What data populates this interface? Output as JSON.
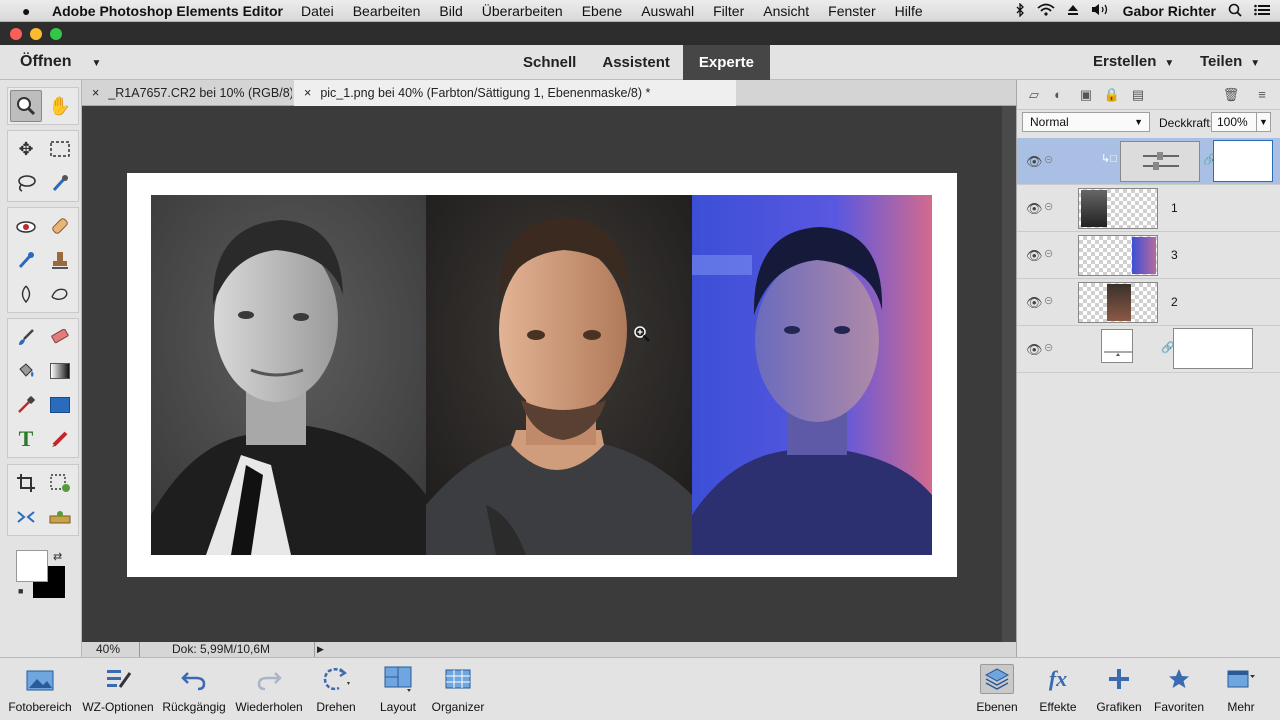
{
  "menubar": {
    "app_name": "Adobe Photoshop Elements Editor",
    "items": [
      "Datei",
      "Bearbeiten",
      "Bild",
      "Überarbeiten",
      "Ebene",
      "Auswahl",
      "Filter",
      "Ansicht",
      "Fenster",
      "Hilfe"
    ],
    "user": "Gabor Richter"
  },
  "modebar": {
    "open_label": "Öffnen",
    "modes": [
      "Schnell",
      "Assistent",
      "Experte"
    ],
    "active_mode": "Experte",
    "create_label": "Erstellen",
    "share_label": "Teilen"
  },
  "tabs": [
    {
      "label": "_R1A7657.CR2 bei 10% (RGB/8)",
      "active": false
    },
    {
      "label": "pic_1.png bei 40% (Farbton/Sättigung 1, Ebenenmaske/8) *",
      "active": true
    }
  ],
  "status": {
    "zoom": "40%",
    "doc": "Dok: 5,99M/10,6M"
  },
  "layers_panel": {
    "blend_mode": "Normal",
    "opacity_label": "Deckkraft:",
    "opacity_value": "100%",
    "layers": [
      {
        "name": "",
        "type": "adjustment",
        "selected": true
      },
      {
        "name": "1",
        "type": "image",
        "selected": false
      },
      {
        "name": "3",
        "type": "image",
        "selected": false
      },
      {
        "name": "2",
        "type": "image",
        "selected": false
      },
      {
        "name": "",
        "type": "background",
        "selected": false
      }
    ]
  },
  "bottombar": {
    "items": [
      {
        "label": "Fotobereich",
        "icon": "photo-bin-icon"
      },
      {
        "label": "WZ-Optionen",
        "icon": "tool-options-icon"
      },
      {
        "label": "Rückgängig",
        "icon": "undo-icon"
      },
      {
        "label": "Wiederholen",
        "icon": "redo-icon"
      },
      {
        "label": "Drehen",
        "icon": "rotate-icon"
      },
      {
        "label": "Layout",
        "icon": "layout-icon"
      },
      {
        "label": "Organizer",
        "icon": "organizer-icon"
      }
    ],
    "right_items": [
      {
        "label": "Ebenen",
        "icon": "layers-icon"
      },
      {
        "label": "Effekte",
        "icon": "effects-icon"
      },
      {
        "label": "Grafiken",
        "icon": "graphics-icon"
      },
      {
        "label": "Favoriten",
        "icon": "favorites-icon"
      },
      {
        "label": "Mehr",
        "icon": "more-icon"
      }
    ]
  },
  "colors": {
    "accent_selected_layer": "#a9c0e4",
    "active_mode_bg": "#464646",
    "canvas_bg": "#3b3b3b"
  }
}
